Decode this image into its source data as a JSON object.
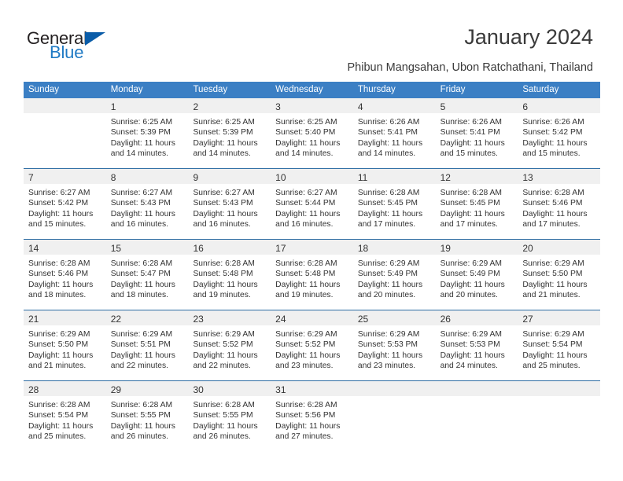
{
  "brand": {
    "name_part1": "General",
    "name_part2": "Blue",
    "triangle_icon": "triangle-icon",
    "color_dark": "#231f20",
    "color_blue": "#1f7ac4",
    "triangle_color": "#0a5ca8"
  },
  "header": {
    "title": "January 2024",
    "location": "Phibun Mangsahan, Ubon Ratchathani, Thailand"
  },
  "theme": {
    "header_row_bg": "#3b7fc4",
    "week_divider": "#2e6da4",
    "daynum_band_bg": "#f0f0f0",
    "text": "#333333"
  },
  "weekdays": [
    "Sunday",
    "Monday",
    "Tuesday",
    "Wednesday",
    "Thursday",
    "Friday",
    "Saturday"
  ],
  "weeks": [
    [
      {
        "day": "",
        "empty": true,
        "sunrise": "",
        "sunset": "",
        "daylight_line1": "",
        "daylight_line2": ""
      },
      {
        "day": "1",
        "empty": false,
        "sunrise": "Sunrise: 6:25 AM",
        "sunset": "Sunset: 5:39 PM",
        "daylight_line1": "Daylight: 11 hours",
        "daylight_line2": "and 14 minutes."
      },
      {
        "day": "2",
        "empty": false,
        "sunrise": "Sunrise: 6:25 AM",
        "sunset": "Sunset: 5:39 PM",
        "daylight_line1": "Daylight: 11 hours",
        "daylight_line2": "and 14 minutes."
      },
      {
        "day": "3",
        "empty": false,
        "sunrise": "Sunrise: 6:25 AM",
        "sunset": "Sunset: 5:40 PM",
        "daylight_line1": "Daylight: 11 hours",
        "daylight_line2": "and 14 minutes."
      },
      {
        "day": "4",
        "empty": false,
        "sunrise": "Sunrise: 6:26 AM",
        "sunset": "Sunset: 5:41 PM",
        "daylight_line1": "Daylight: 11 hours",
        "daylight_line2": "and 14 minutes."
      },
      {
        "day": "5",
        "empty": false,
        "sunrise": "Sunrise: 6:26 AM",
        "sunset": "Sunset: 5:41 PM",
        "daylight_line1": "Daylight: 11 hours",
        "daylight_line2": "and 15 minutes."
      },
      {
        "day": "6",
        "empty": false,
        "sunrise": "Sunrise: 6:26 AM",
        "sunset": "Sunset: 5:42 PM",
        "daylight_line1": "Daylight: 11 hours",
        "daylight_line2": "and 15 minutes."
      }
    ],
    [
      {
        "day": "7",
        "empty": false,
        "sunrise": "Sunrise: 6:27 AM",
        "sunset": "Sunset: 5:42 PM",
        "daylight_line1": "Daylight: 11 hours",
        "daylight_line2": "and 15 minutes."
      },
      {
        "day": "8",
        "empty": false,
        "sunrise": "Sunrise: 6:27 AM",
        "sunset": "Sunset: 5:43 PM",
        "daylight_line1": "Daylight: 11 hours",
        "daylight_line2": "and 16 minutes."
      },
      {
        "day": "9",
        "empty": false,
        "sunrise": "Sunrise: 6:27 AM",
        "sunset": "Sunset: 5:43 PM",
        "daylight_line1": "Daylight: 11 hours",
        "daylight_line2": "and 16 minutes."
      },
      {
        "day": "10",
        "empty": false,
        "sunrise": "Sunrise: 6:27 AM",
        "sunset": "Sunset: 5:44 PM",
        "daylight_line1": "Daylight: 11 hours",
        "daylight_line2": "and 16 minutes."
      },
      {
        "day": "11",
        "empty": false,
        "sunrise": "Sunrise: 6:28 AM",
        "sunset": "Sunset: 5:45 PM",
        "daylight_line1": "Daylight: 11 hours",
        "daylight_line2": "and 17 minutes."
      },
      {
        "day": "12",
        "empty": false,
        "sunrise": "Sunrise: 6:28 AM",
        "sunset": "Sunset: 5:45 PM",
        "daylight_line1": "Daylight: 11 hours",
        "daylight_line2": "and 17 minutes."
      },
      {
        "day": "13",
        "empty": false,
        "sunrise": "Sunrise: 6:28 AM",
        "sunset": "Sunset: 5:46 PM",
        "daylight_line1": "Daylight: 11 hours",
        "daylight_line2": "and 17 minutes."
      }
    ],
    [
      {
        "day": "14",
        "empty": false,
        "sunrise": "Sunrise: 6:28 AM",
        "sunset": "Sunset: 5:46 PM",
        "daylight_line1": "Daylight: 11 hours",
        "daylight_line2": "and 18 minutes."
      },
      {
        "day": "15",
        "empty": false,
        "sunrise": "Sunrise: 6:28 AM",
        "sunset": "Sunset: 5:47 PM",
        "daylight_line1": "Daylight: 11 hours",
        "daylight_line2": "and 18 minutes."
      },
      {
        "day": "16",
        "empty": false,
        "sunrise": "Sunrise: 6:28 AM",
        "sunset": "Sunset: 5:48 PM",
        "daylight_line1": "Daylight: 11 hours",
        "daylight_line2": "and 19 minutes."
      },
      {
        "day": "17",
        "empty": false,
        "sunrise": "Sunrise: 6:28 AM",
        "sunset": "Sunset: 5:48 PM",
        "daylight_line1": "Daylight: 11 hours",
        "daylight_line2": "and 19 minutes."
      },
      {
        "day": "18",
        "empty": false,
        "sunrise": "Sunrise: 6:29 AM",
        "sunset": "Sunset: 5:49 PM",
        "daylight_line1": "Daylight: 11 hours",
        "daylight_line2": "and 20 minutes."
      },
      {
        "day": "19",
        "empty": false,
        "sunrise": "Sunrise: 6:29 AM",
        "sunset": "Sunset: 5:49 PM",
        "daylight_line1": "Daylight: 11 hours",
        "daylight_line2": "and 20 minutes."
      },
      {
        "day": "20",
        "empty": false,
        "sunrise": "Sunrise: 6:29 AM",
        "sunset": "Sunset: 5:50 PM",
        "daylight_line1": "Daylight: 11 hours",
        "daylight_line2": "and 21 minutes."
      }
    ],
    [
      {
        "day": "21",
        "empty": false,
        "sunrise": "Sunrise: 6:29 AM",
        "sunset": "Sunset: 5:50 PM",
        "daylight_line1": "Daylight: 11 hours",
        "daylight_line2": "and 21 minutes."
      },
      {
        "day": "22",
        "empty": false,
        "sunrise": "Sunrise: 6:29 AM",
        "sunset": "Sunset: 5:51 PM",
        "daylight_line1": "Daylight: 11 hours",
        "daylight_line2": "and 22 minutes."
      },
      {
        "day": "23",
        "empty": false,
        "sunrise": "Sunrise: 6:29 AM",
        "sunset": "Sunset: 5:52 PM",
        "daylight_line1": "Daylight: 11 hours",
        "daylight_line2": "and 22 minutes."
      },
      {
        "day": "24",
        "empty": false,
        "sunrise": "Sunrise: 6:29 AM",
        "sunset": "Sunset: 5:52 PM",
        "daylight_line1": "Daylight: 11 hours",
        "daylight_line2": "and 23 minutes."
      },
      {
        "day": "25",
        "empty": false,
        "sunrise": "Sunrise: 6:29 AM",
        "sunset": "Sunset: 5:53 PM",
        "daylight_line1": "Daylight: 11 hours",
        "daylight_line2": "and 23 minutes."
      },
      {
        "day": "26",
        "empty": false,
        "sunrise": "Sunrise: 6:29 AM",
        "sunset": "Sunset: 5:53 PM",
        "daylight_line1": "Daylight: 11 hours",
        "daylight_line2": "and 24 minutes."
      },
      {
        "day": "27",
        "empty": false,
        "sunrise": "Sunrise: 6:29 AM",
        "sunset": "Sunset: 5:54 PM",
        "daylight_line1": "Daylight: 11 hours",
        "daylight_line2": "and 25 minutes."
      }
    ],
    [
      {
        "day": "28",
        "empty": false,
        "sunrise": "Sunrise: 6:28 AM",
        "sunset": "Sunset: 5:54 PM",
        "daylight_line1": "Daylight: 11 hours",
        "daylight_line2": "and 25 minutes."
      },
      {
        "day": "29",
        "empty": false,
        "sunrise": "Sunrise: 6:28 AM",
        "sunset": "Sunset: 5:55 PM",
        "daylight_line1": "Daylight: 11 hours",
        "daylight_line2": "and 26 minutes."
      },
      {
        "day": "30",
        "empty": false,
        "sunrise": "Sunrise: 6:28 AM",
        "sunset": "Sunset: 5:55 PM",
        "daylight_line1": "Daylight: 11 hours",
        "daylight_line2": "and 26 minutes."
      },
      {
        "day": "31",
        "empty": false,
        "sunrise": "Sunrise: 6:28 AM",
        "sunset": "Sunset: 5:56 PM",
        "daylight_line1": "Daylight: 11 hours",
        "daylight_line2": "and 27 minutes."
      },
      {
        "day": "",
        "empty": true,
        "sunrise": "",
        "sunset": "",
        "daylight_line1": "",
        "daylight_line2": ""
      },
      {
        "day": "",
        "empty": true,
        "sunrise": "",
        "sunset": "",
        "daylight_line1": "",
        "daylight_line2": ""
      },
      {
        "day": "",
        "empty": true,
        "sunrise": "",
        "sunset": "",
        "daylight_line1": "",
        "daylight_line2": ""
      }
    ]
  ]
}
